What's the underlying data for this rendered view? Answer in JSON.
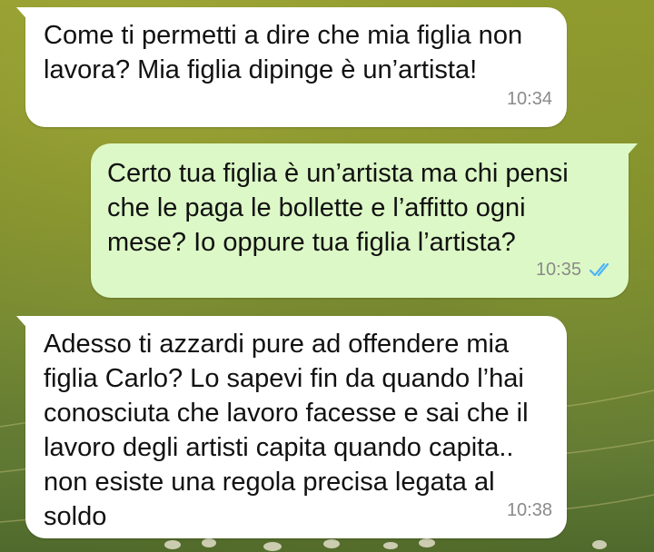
{
  "chat": {
    "messages": [
      {
        "direction": "incoming",
        "text": "Come ti permetti a dire che mia figlia non\nlavora? Mia figlia dipinge è un’artista!",
        "time": "10:34"
      },
      {
        "direction": "outgoing",
        "text": "Certo tua figlia è un’artista ma chi pensi\nche le paga le bollette e l’affitto ogni\nmese? Io oppure tua figlia l’artista?",
        "time": "10:35",
        "status_icon": "double-check-read-icon"
      },
      {
        "direction": "incoming",
        "text": "Adesso ti azzardi pure ad offendere mia\nfiglia Carlo? Lo sapevi fin da quando l’hai\nconosciuta che lavoro facesse e sai  che il\nlavoro degli artisti capita quando capita..\nnon esiste una regola precisa legata al\nsoldo",
        "time": "10:38"
      }
    ]
  },
  "colors": {
    "incoming_bubble": "#ffffff",
    "outgoing_bubble": "#dcf8c6",
    "read_ticks": "#4fb3f6",
    "timestamp": "#8a8a8a"
  }
}
